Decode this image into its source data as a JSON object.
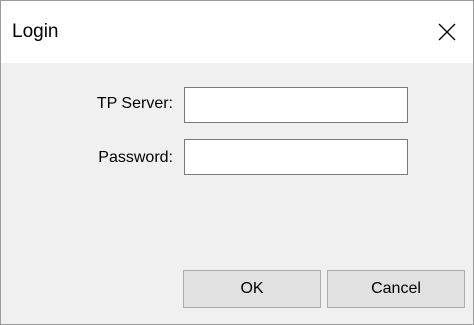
{
  "window": {
    "title": "Login",
    "close_icon": "close-x"
  },
  "form": {
    "server_label": "TP Server:",
    "server_value": "",
    "password_label": "Password:",
    "password_value": ""
  },
  "buttons": {
    "ok_label": "OK",
    "cancel_label": "Cancel"
  },
  "colors": {
    "titlebar_bg": "#ffffff",
    "client_bg": "#f0f0f0",
    "button_bg": "#e1e1e1"
  }
}
